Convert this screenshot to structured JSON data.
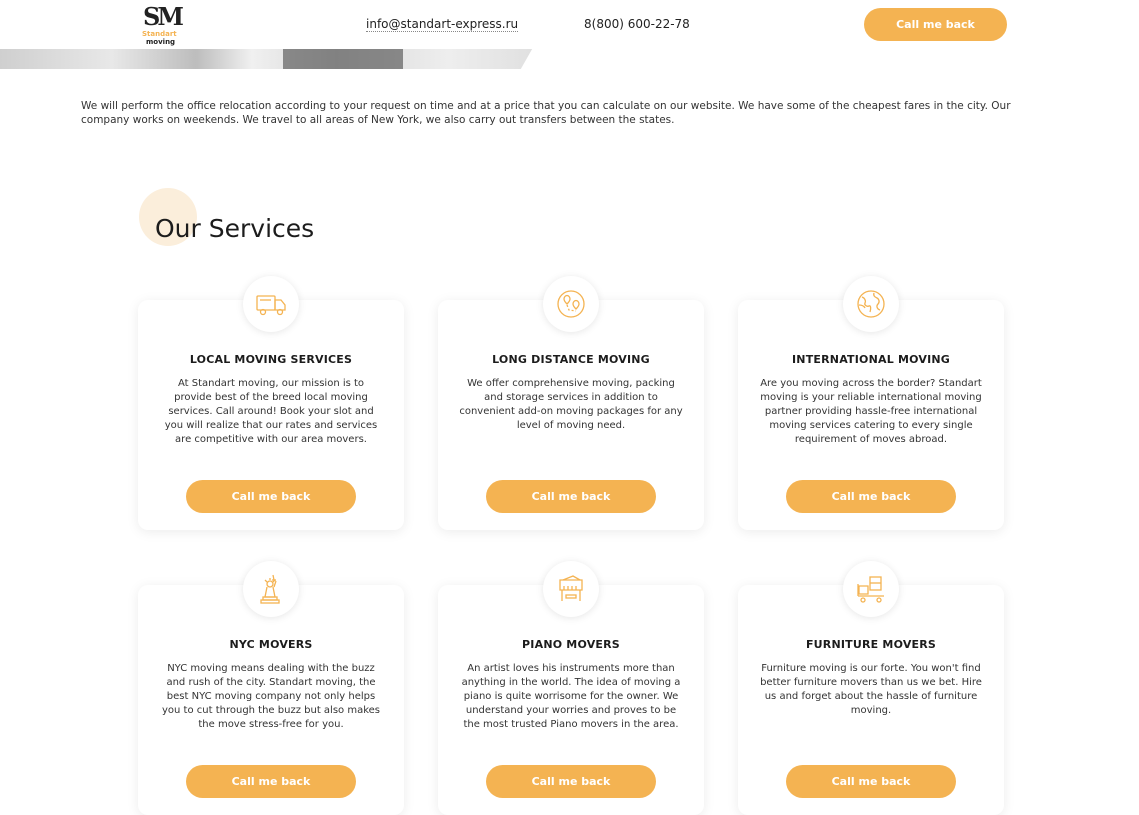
{
  "header": {
    "logo_mark": "SM",
    "logo_word_1": "Standart",
    "logo_word_2": "moving",
    "email": "info@standart-express.ru",
    "phone": "8(800) 600-22-78",
    "cta_label": "Call me back"
  },
  "intro_text": "We will perform the office relocation according to your request on time and at a price that you can calculate on our website. We have some of the cheapest fares in the city. Our company works on weekends. We travel to all areas of New York, we also carry out transfers between the states.",
  "services": {
    "title": "Our Services",
    "accent_color": "#f4b352",
    "items": [
      {
        "icon": "truck-icon",
        "title": "LOCAL MOVING SERVICES",
        "text": "At Standart moving, our mission is to provide best of the breed local moving services. Call around! Book your slot and you will realize that our rates and services are competitive with our area movers.",
        "button": "Call me back"
      },
      {
        "icon": "route-map-icon",
        "title": "LONG DISTANCE MOVING",
        "text": "We offer comprehensive moving, packing and storage services in addition to convenient add-on moving packages for any level of moving need.",
        "button": "Call me back"
      },
      {
        "icon": "globe-icon",
        "title": "INTERNATIONAL MOVING",
        "text": "Are you moving across the border? Standart moving is your reliable international moving partner providing hassle-free international moving services catering to every single requirement of moves abroad.",
        "button": "Call me back"
      },
      {
        "icon": "statue-of-liberty-icon",
        "title": "NYC MOVERS",
        "text": "NYC moving means dealing with the buzz and rush of the city. Standart moving, the best NYC moving company not only helps you to cut through the buzz but also makes the move stress-free for you.",
        "button": "Call me back"
      },
      {
        "icon": "piano-icon",
        "title": "PIANO MOVERS",
        "text": "An artist loves his instruments more than anything in the world. The idea of moving a piano is quite worrisome for the owner. We understand your worries and proves to be the most trusted Piano movers in the area.",
        "button": "Call me back"
      },
      {
        "icon": "furniture-cart-icon",
        "title": "FURNITURE MOVERS",
        "text": "Furniture moving is our forte. You won't find better furniture movers than us we bet. Hire us and forget about the hassle of furniture moving.",
        "button": "Call me back"
      }
    ]
  }
}
